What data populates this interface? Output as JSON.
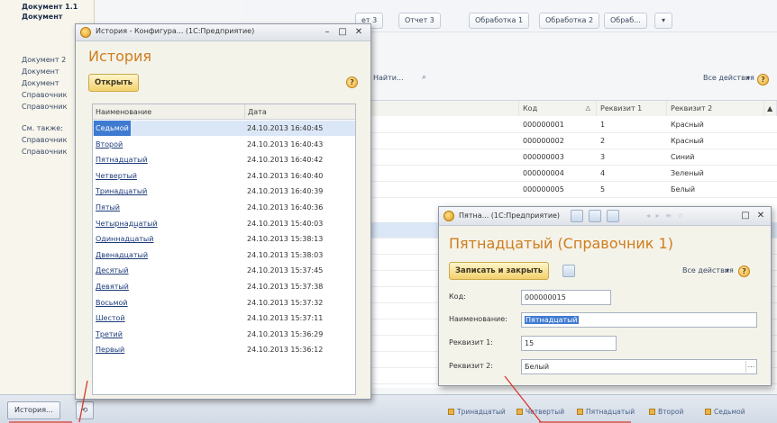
{
  "left_panel": {
    "bold_links": [
      "Документ 1.1",
      "Документ"
    ],
    "links": [
      "Документ 2",
      "Документ",
      "Документ",
      "Справочник",
      "Справочник",
      "См. также:",
      "Справочник",
      "Справочник"
    ]
  },
  "top_tabs": [
    "ет 3",
    "Отчет 3",
    "Обработка 1",
    "Обработка 2",
    "Обраб..."
  ],
  "bg_toolbar": {
    "find": "Найти...",
    "all_actions": "Все действия"
  },
  "bg_table": {
    "headers": [
      "Код",
      "Реквизит 1",
      "Реквизит 2"
    ],
    "rows": [
      [
        "000000001",
        "1",
        "Красный"
      ],
      [
        "000000002",
        "2",
        "Красный"
      ],
      [
        "000000003",
        "3",
        "Синий"
      ],
      [
        "000000004",
        "4",
        "Зеленый"
      ],
      [
        "000000005",
        "5",
        "Белый"
      ]
    ]
  },
  "history_window": {
    "title": "История - Конфигура... (1С:Предприятие)",
    "heading": "История",
    "open_button": "Открыть",
    "columns": [
      "Наименование",
      "Дата"
    ],
    "rows": [
      {
        "name": "Седьмой",
        "date": "24.10.2013 16:40:45",
        "selected": true
      },
      {
        "name": "Второй",
        "date": "24.10.2013 16:40:43"
      },
      {
        "name": "Пятнадцатый",
        "date": "24.10.2013 16:40:42"
      },
      {
        "name": "Четвертый",
        "date": "24.10.2013 16:40:40"
      },
      {
        "name": "Тринадцатый",
        "date": "24.10.2013 16:40:39"
      },
      {
        "name": "Пятый",
        "date": "24.10.2013 16:40:36"
      },
      {
        "name": "Четырнадцатый",
        "date": "24.10.2013 15:40:03"
      },
      {
        "name": "Одиннадцатый",
        "date": "24.10.2013 15:38:13"
      },
      {
        "name": "Двенадцатый",
        "date": "24.10.2013 15:38:03"
      },
      {
        "name": "Десятый",
        "date": "24.10.2013 15:37:45"
      },
      {
        "name": "Девятый",
        "date": "24.10.2013 15:37:38"
      },
      {
        "name": "Восьмой",
        "date": "24.10.2013 15:37:32"
      },
      {
        "name": "Шестой",
        "date": "24.10.2013 15:37:11"
      },
      {
        "name": "Третий",
        "date": "24.10.2013 15:36:29"
      },
      {
        "name": "Первый",
        "date": "24.10.2013 15:36:12"
      }
    ]
  },
  "item_window": {
    "title": "Пятна... (1С:Предприятие)",
    "heading": "Пятнадцатый (Справочник 1)",
    "save_close": "Записать и закрыть",
    "all_actions": "Все действия",
    "fields": {
      "code_label": "Код:",
      "code_value": "000000015",
      "name_label": "Наименование:",
      "name_value": "Пятнадцатый",
      "attr1_label": "Реквизит 1:",
      "attr1_value": "15",
      "attr2_label": "Реквизит 2:",
      "attr2_value": "Белый"
    }
  },
  "taskbar": {
    "history_button": "История...",
    "items": [
      "Тринадцатый",
      "Четвертый",
      "Пятнадцатый",
      "Второй",
      "Седьмой"
    ]
  },
  "colors": {
    "accent_orange": "#cf7d1d",
    "selection_blue": "#3f7ad1",
    "annotation_red": "#d9362b"
  }
}
